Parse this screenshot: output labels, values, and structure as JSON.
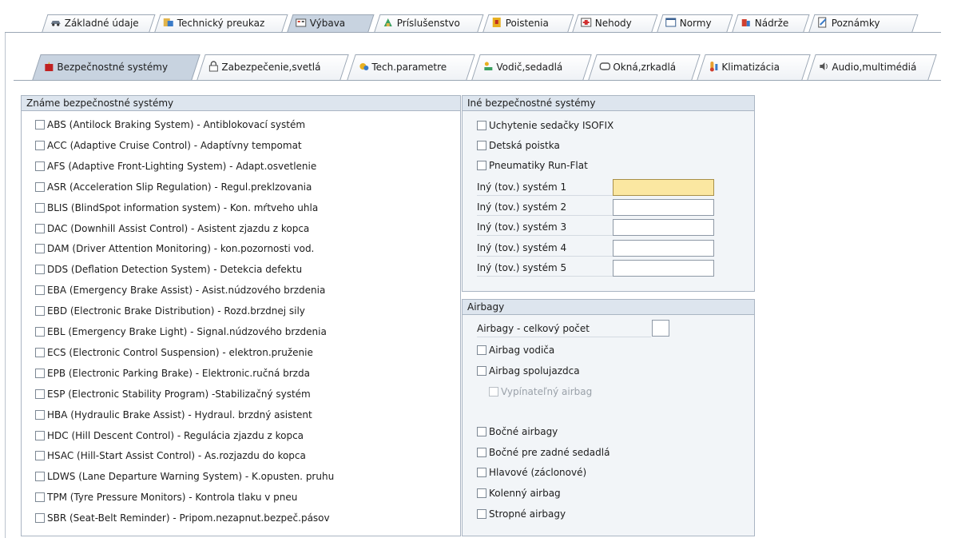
{
  "tabs": [
    {
      "label": "Základné údaje",
      "icon": "car-icon"
    },
    {
      "label": "Technický preukaz",
      "icon": "tech-doc-icon"
    },
    {
      "label": "Výbava",
      "icon": "equipment-icon",
      "active": true
    },
    {
      "label": "Príslušenstvo",
      "icon": "accessories-icon"
    },
    {
      "label": "Poistenia",
      "icon": "insurance-icon"
    },
    {
      "label": "Nehody",
      "icon": "accident-icon"
    },
    {
      "label": "Normy",
      "icon": "norms-icon"
    },
    {
      "label": "Nádrže",
      "icon": "tank-icon"
    },
    {
      "label": "Poznámky",
      "icon": "notes-icon"
    }
  ],
  "subtabs": [
    {
      "label": "Bezpečnostné systémy",
      "icon": "safety-icon",
      "active": true
    },
    {
      "label": "Zabezpečenie,svetlá",
      "icon": "lock-icon"
    },
    {
      "label": "Tech.parametre",
      "icon": "parameters-icon"
    },
    {
      "label": "Vodič,sedadlá",
      "icon": "driver-seat-icon"
    },
    {
      "label": "Okná,zrkadlá",
      "icon": "window-icon"
    },
    {
      "label": "Klimatizácia",
      "icon": "air-conditioning-icon"
    },
    {
      "label": "Audio,multimédiá",
      "icon": "speaker-icon"
    }
  ],
  "known_group": {
    "title": "Známe bezpečnostné systémy",
    "items": [
      "ABS (Antilock Braking System) - Antiblokovací systém",
      "ACC (Adaptive Cruise Control) - Adaptívny tempomat",
      "AFS (Adaptive Front-Lighting System) - Adapt.osvetlenie",
      "ASR (Acceleration Slip Regulation) - Regul.preklzovania",
      "BLIS (BlindSpot information system) - Kon. mŕtveho uhla",
      "DAC (Downhill Assist Control) - Asistent zjazdu z kopca",
      "DAM (Driver Attention Monitoring) - kon.pozornosti vod.",
      "DDS (Deflation Detection System) - Detekcia defektu",
      "EBA (Emergency Brake Assist) - Asist.núdzového brzdenia",
      "EBD (Electronic Brake Distribution) - Rozd.brzdnej sily",
      "EBL (Emergency Brake Light) - Signal.núdzového brzdenia",
      "ECS (Electronic Control Suspension) - elektron.pruženie",
      "EPB (Electronic Parking Brake) - Elektronic.ručná brzda",
      "ESP (Electronic Stability Program) -Stabilizačný systém",
      "HBA (Hydraulic Brake Assist) - Hydraul. brzdný asistent",
      "HDC (Hill Descent Control) - Regulácia zjazdu z kopca",
      "HSAC (Hill-Start Assist Control) - As.rozjazdu do kopca",
      "LDWS (Lane Departure Warning System) - K.opusten. pruhu",
      "TPM (Tyre Pressure Monitors) - Kontrola tlaku v pneu",
      "SBR (Seat-Belt Reminder) - Pripom.nezapnut.bezpeč.pásov"
    ]
  },
  "other_group": {
    "title": "Iné bezpečnostné systémy",
    "checkboxes": [
      "Uchytenie sedačky ISOFIX",
      "Detská poistka",
      "Pneumatiky Run-Flat"
    ],
    "fields": [
      {
        "label": "Iný (tov.) systém 1",
        "value": ""
      },
      {
        "label": "Iný (tov.) systém 2",
        "value": ""
      },
      {
        "label": "Iný (tov.) systém 3",
        "value": ""
      },
      {
        "label": "Iný (tov.) systém 4",
        "value": ""
      },
      {
        "label": "Iný (tov.) systém 5",
        "value": ""
      }
    ]
  },
  "airbag_group": {
    "title": "Airbagy",
    "count_label": "Airbagy - celkový počet",
    "count_value": "",
    "items_top": [
      "Airbag vodiča",
      "Airbag spolujazdca"
    ],
    "disabled_item": "Vypínateľný airbag",
    "items_bottom": [
      "Bočné airbagy",
      "Bočné pre zadné sedadlá",
      "Hlavové (záclonové)",
      "Kolenný airbag",
      "Stropné airbagy"
    ]
  },
  "colors": {
    "focus_field": "#fbe7a1",
    "group_header": "#dde5ee",
    "active_tab": "#c8d3e0"
  }
}
